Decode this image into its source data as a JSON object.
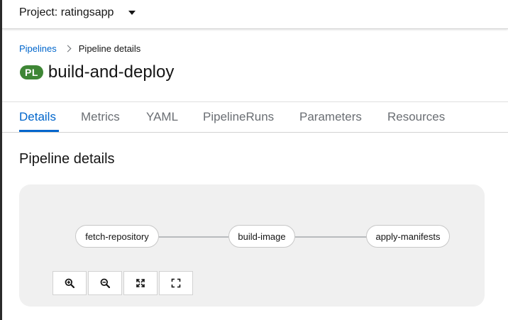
{
  "header": {
    "project_label": "Project: ratingsapp"
  },
  "breadcrumb": {
    "items": [
      "Pipelines",
      "Pipeline details"
    ]
  },
  "title": {
    "badge": "PL",
    "text": "build-and-deploy",
    "badge_color": "#3e8635"
  },
  "tabs": [
    {
      "label": "Details",
      "active": true
    },
    {
      "label": "Metrics",
      "active": false
    },
    {
      "label": "YAML",
      "active": false
    },
    {
      "label": "PipelineRuns",
      "active": false
    },
    {
      "label": "Parameters",
      "active": false
    },
    {
      "label": "Resources",
      "active": false
    }
  ],
  "section": {
    "title": "Pipeline details"
  },
  "pipeline": {
    "tasks": [
      "fetch-repository",
      "build-image",
      "apply-manifests"
    ]
  },
  "controls": [
    {
      "icon": "zoom-in-icon"
    },
    {
      "icon": "zoom-out-icon"
    },
    {
      "icon": "fit-to-screen-icon"
    },
    {
      "icon": "reset-view-icon"
    }
  ],
  "colors": {
    "accent": "#0066cc",
    "badge": "#3e8635"
  }
}
